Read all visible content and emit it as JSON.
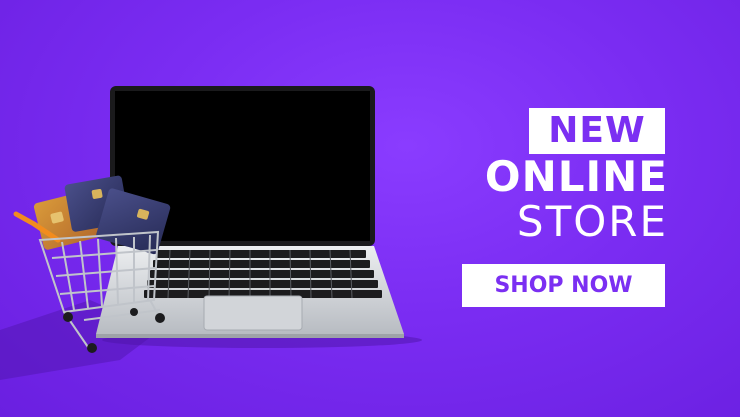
{
  "hero": {
    "headline_new": "NEW",
    "headline_online": "ONLINE",
    "headline_store": "STORE",
    "cta_label": "SHOP NOW"
  },
  "colors": {
    "background": "#7a2cf2",
    "accent_text": "#7b2ff2",
    "white": "#ffffff"
  },
  "illustration": {
    "laptop_icon": "laptop-icon",
    "cart_icon": "shopping-cart-icon",
    "card_icon": "credit-card-icon"
  }
}
